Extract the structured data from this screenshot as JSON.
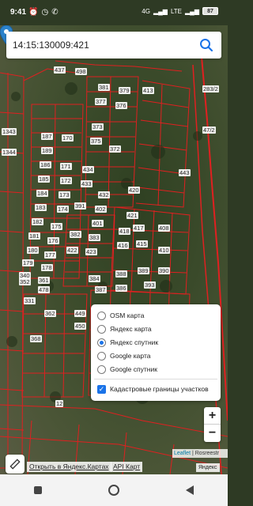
{
  "status_bar": {
    "time": "9:41",
    "left_icons": [
      "alarm-icon",
      "clock-icon",
      "whatsapp-icon"
    ],
    "signal_4g": "4G",
    "signal_lte": "LTE",
    "battery": "87"
  },
  "search": {
    "value": "14:15:130009:421",
    "icon": "search-icon"
  },
  "parcels": [
    {
      "label": "437"
    },
    {
      "label": "498"
    },
    {
      "label": "381"
    },
    {
      "label": "379"
    },
    {
      "label": "377"
    },
    {
      "label": "376"
    },
    {
      "label": "373"
    },
    {
      "label": "187"
    },
    {
      "label": "170"
    },
    {
      "label": "189"
    },
    {
      "label": "186"
    },
    {
      "label": "171"
    },
    {
      "label": "185"
    },
    {
      "label": "172"
    },
    {
      "label": "184"
    },
    {
      "label": "173"
    },
    {
      "label": "183"
    },
    {
      "label": "174"
    },
    {
      "label": "182"
    },
    {
      "label": "175"
    },
    {
      "label": "181"
    },
    {
      "label": "176"
    },
    {
      "label": "180"
    },
    {
      "label": "177"
    },
    {
      "label": "179"
    },
    {
      "label": "178"
    },
    {
      "label": "340"
    },
    {
      "label": "478"
    },
    {
      "label": "352"
    },
    {
      "label": "361"
    },
    {
      "label": "331"
    },
    {
      "label": "362"
    },
    {
      "label": "368"
    },
    {
      "label": "375"
    },
    {
      "label": "372"
    },
    {
      "label": "434"
    },
    {
      "label": "433"
    },
    {
      "label": "432"
    },
    {
      "label": "391"
    },
    {
      "label": "402"
    },
    {
      "label": "401"
    },
    {
      "label": "382"
    },
    {
      "label": "383"
    },
    {
      "label": "422"
    },
    {
      "label": "423"
    },
    {
      "label": "416"
    },
    {
      "label": "415"
    },
    {
      "label": "417"
    },
    {
      "label": "418"
    },
    {
      "label": "420"
    },
    {
      "label": "421"
    },
    {
      "label": "384"
    },
    {
      "label": "388"
    },
    {
      "label": "389"
    },
    {
      "label": "386"
    },
    {
      "label": "387"
    },
    {
      "label": "393"
    },
    {
      "label": "390"
    },
    {
      "label": "449"
    },
    {
      "label": "450"
    },
    {
      "label": "443"
    },
    {
      "label": "1343"
    },
    {
      "label": "1344"
    },
    {
      "label": "283/2"
    },
    {
      "label": "47/2"
    },
    {
      "label": "413"
    },
    {
      "label": "408"
    },
    {
      "label": "410"
    },
    {
      "label": "12"
    }
  ],
  "layers": {
    "options": [
      {
        "label": "OSM карта",
        "selected": false
      },
      {
        "label": "Яндекс карта",
        "selected": false
      },
      {
        "label": "Яндекс спутник",
        "selected": true
      },
      {
        "label": "Google карта",
        "selected": false
      },
      {
        "label": "Google спутник",
        "selected": false
      }
    ],
    "overlay": {
      "label": "Кадастровые границы участков",
      "checked": true
    }
  },
  "zoom": {
    "in": "+",
    "out": "−"
  },
  "attribution": {
    "leaflet": "Leaflet",
    "rest": " | Rosreestr"
  },
  "links": {
    "open_yandex": "Открыть в Яндекс.Картах",
    "api": "API Карт",
    "yandex_logo": "Яндекс"
  },
  "colors": {
    "parcel_border": "#e02020",
    "accent": "#1a73e8"
  }
}
